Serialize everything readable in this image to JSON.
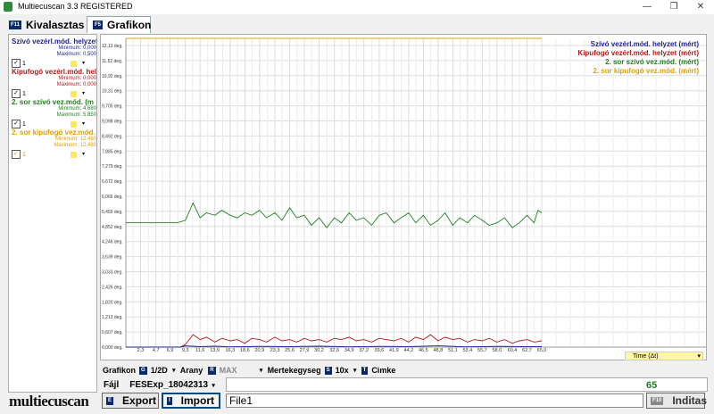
{
  "window": {
    "title": "Multiecuscan 3.3 REGISTERED",
    "min": "—",
    "max": "❐",
    "close": "✕"
  },
  "tabs": [
    {
      "key": "F11",
      "label": "Kivalasztas"
    },
    {
      "key": "F5",
      "label": "Grafikon"
    }
  ],
  "left_series": [
    {
      "name": "Szívó vezérl.mód. helyzet",
      "min_label": "Minimum: 0,000",
      "max_label": "Maximum: 0,500",
      "check": "✓",
      "value": "1",
      "color": "#1f1f8f"
    },
    {
      "name": "Kipufogó vezérl.mód. helyzet",
      "min_label": "Minimum: 0,000",
      "max_label": "Maximum: 0,000",
      "check": "✓",
      "value": "1",
      "color": "#b01a1a"
    },
    {
      "name": "2. sor szívó vez.mód. (m",
      "min_label": "Minimum: 4,680",
      "max_label": "Maximum: 5,850",
      "check": "✓",
      "value": "1",
      "color": "#1f7f1f"
    },
    {
      "name": "2. sor kipufogó vez.mód.",
      "min_label": "Minimum: 12,480",
      "max_label": "Maximum: 12,480",
      "check": "✓",
      "value": "1",
      "color": "#e0a000"
    }
  ],
  "legend": [
    {
      "label": "Szívó vezérl.mód. helyzet (mért)",
      "color": "#1f1f8f"
    },
    {
      "label": "Kipufogó vezérl.mód. helyzet (mért)",
      "color": "#b01a1a"
    },
    {
      "label": "2. sor szívó vez.mód. (mért)",
      "color": "#1f7f1f"
    },
    {
      "label": "2. sor kipufogó vez.mód. (mért)",
      "color": "#e0a000"
    }
  ],
  "chart_data": {
    "type": "line",
    "y_tick_labels": [
      "0,000 deg.",
      "0,607 deg.",
      "1,213 deg.",
      "1,820 deg.",
      "2,426 deg.",
      "3,033 deg.",
      "3,639 deg.",
      "4,246 deg.",
      "4,852 deg.",
      "5,459 deg.",
      "6,066 deg.",
      "6,672 deg.",
      "7,279 deg.",
      "7,885 deg.",
      "8,492 deg.",
      "9,098 deg.",
      "9,705 deg.",
      "10,31 deg.",
      "10,92 deg.",
      "11,52 deg.",
      "12,13 deg."
    ],
    "ylim": [
      0,
      12.13
    ],
    "x_tick_labels": [
      "2,3",
      "4,7",
      "6,9",
      "9,3",
      "11,6",
      "13,9",
      "16,3",
      "18,6",
      "20,9",
      "23,3",
      "25,6",
      "27,9",
      "30,2",
      "32,6",
      "34,9",
      "37,2",
      "39,6",
      "41,9",
      "44,2",
      "46,5",
      "48,8",
      "51,1",
      "53,4",
      "55,7",
      "58,0",
      "60,4",
      "62,7",
      "65,0"
    ],
    "xlim": [
      0,
      65
    ],
    "series": [
      {
        "name": "2. sor kipufogó vez.mód. (mért)",
        "color": "#e0a000",
        "x": [
          0,
          65
        ],
        "y": [
          12.48,
          12.48
        ]
      },
      {
        "name": "2. sor szívó vez.mód. (mért)",
        "color": "#1f7f1f",
        "x": [
          0,
          8,
          9.3,
          10.5,
          11.6,
          12.6,
          13.9,
          15,
          16.3,
          17.4,
          18.6,
          19.7,
          20.9,
          22,
          23.3,
          24.4,
          25.6,
          26.7,
          27.9,
          29,
          30.2,
          31.4,
          32.6,
          33.7,
          34.9,
          36,
          37.2,
          38.4,
          39.6,
          40.7,
          41.9,
          43,
          44.2,
          45.3,
          46.5,
          47.6,
          48.8,
          49.9,
          51.1,
          52.2,
          53.4,
          54.5,
          55.7,
          56.8,
          58,
          59.2,
          60.4,
          61.5,
          62.7,
          63.8,
          64.4,
          65
        ],
        "y": [
          5.0,
          5.0,
          5.1,
          5.8,
          5.2,
          5.4,
          5.3,
          5.5,
          5.3,
          5.2,
          5.4,
          5.3,
          5.5,
          5.2,
          5.4,
          5.1,
          5.6,
          5.2,
          5.3,
          4.9,
          5.2,
          4.8,
          5.2,
          5.0,
          5.4,
          5.1,
          5.2,
          4.9,
          5.3,
          5.4,
          5.0,
          5.2,
          5.4,
          5.0,
          5.3,
          4.9,
          5.1,
          5.4,
          4.9,
          5.2,
          5.0,
          5.3,
          5.1,
          4.9,
          5.0,
          5.2,
          4.8,
          5.0,
          5.3,
          5.0,
          5.5,
          5.4
        ]
      },
      {
        "name": "Kipufogó vezérl.mód. helyzet (mért)",
        "color": "#b01a1a",
        "x": [
          0,
          8.5,
          9.3,
          10.5,
          11.6,
          12.6,
          13.9,
          15,
          16.3,
          17.4,
          18.6,
          19.7,
          20.9,
          22,
          23.3,
          24.4,
          25.6,
          26.7,
          27.9,
          29,
          30.2,
          31.4,
          32.6,
          33.7,
          34.9,
          36,
          37.2,
          38.4,
          39.6,
          40.7,
          41.9,
          43,
          44.2,
          45.3,
          46.5,
          47.6,
          48.8,
          49.9,
          51.1,
          52.2,
          53.4,
          54.5,
          55.7,
          56.8,
          58,
          59.2,
          60.4,
          61.5,
          62.7,
          63.8,
          65
        ],
        "y": [
          0.0,
          0.0,
          0.1,
          0.5,
          0.3,
          0.4,
          0.2,
          0.35,
          0.25,
          0.3,
          0.15,
          0.35,
          0.3,
          0.2,
          0.4,
          0.25,
          0.3,
          0.2,
          0.35,
          0.25,
          0.3,
          0.2,
          0.35,
          0.3,
          0.4,
          0.25,
          0.3,
          0.2,
          0.35,
          0.3,
          0.25,
          0.35,
          0.2,
          0.4,
          0.3,
          0.5,
          0.25,
          0.4,
          0.3,
          0.35,
          0.2,
          0.3,
          0.25,
          0.35,
          0.2,
          0.3,
          0.15,
          0.25,
          0.3,
          0.2,
          0.25
        ]
      },
      {
        "name": "Szívó vezérl.mód. helyzet (mért)",
        "color": "#1f1f8f",
        "x": [
          0,
          8.5,
          9.3,
          11.6,
          13.9,
          16.3,
          20.9,
          25.6,
          30.2,
          34.9,
          39.6,
          44.2,
          48.8,
          53.4,
          58,
          62.7,
          65
        ],
        "y": [
          0,
          0,
          0.05,
          0.02,
          0.04,
          0.01,
          0.03,
          0.02,
          0.04,
          0.01,
          0.03,
          0.02,
          0.05,
          0.01,
          0.03,
          0.02,
          0.02
        ]
      }
    ]
  },
  "timebox": {
    "label": "Time (Δt)",
    "dd": "▾"
  },
  "bottom": {
    "grafikon": "Grafikon",
    "grafikon_key": "G",
    "grafikon_value": "1/2D",
    "arany": "Arany",
    "arany_key": "R",
    "arany_value": "MAX",
    "mertekegyseg": "Mertekegyseg",
    "mert_key": "S",
    "mert_value": "10x",
    "cimke_key": "T",
    "cimke": "Cimke",
    "dd": "▾",
    "fajl": "Fájl",
    "fajl_value": "FESExp_18042313",
    "export_key": "E",
    "export": "Export",
    "import_key": "I",
    "import": "Import",
    "file_input": "File1",
    "counter": "65",
    "inditas_key": "F10",
    "inditas": "Inditas"
  }
}
